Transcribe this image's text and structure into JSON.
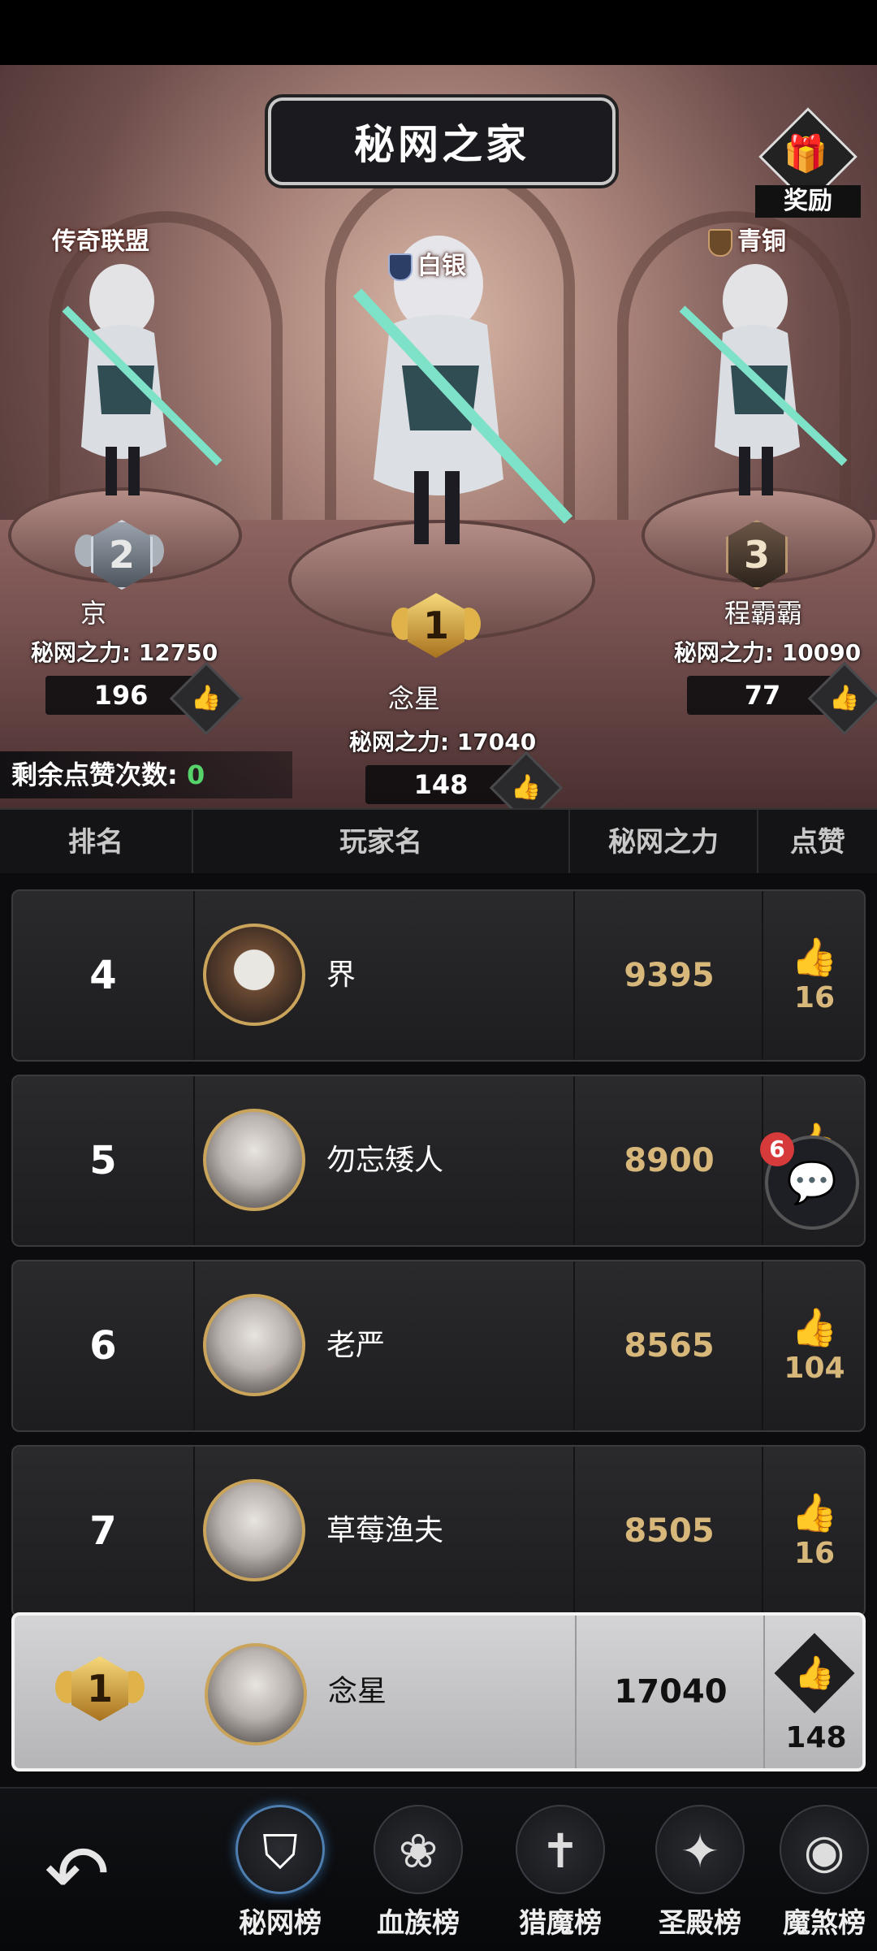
{
  "header": {
    "title": "秘网之家",
    "reward_label": "奖励"
  },
  "podium": {
    "first": {
      "tier": "白银",
      "rank": "1",
      "name": "念星",
      "power_text": "秘网之力: 17040",
      "likes": "148"
    },
    "second": {
      "tier": "传奇联盟",
      "rank": "2",
      "name": "京",
      "power_text": "秘网之力: 12750",
      "likes": "196"
    },
    "third": {
      "tier": "青铜",
      "rank": "3",
      "name": "程霸霸",
      "power_text": "秘网之力: 10090",
      "likes": "77"
    }
  },
  "remaining_likes": {
    "label": "剩余点赞次数:",
    "value": "0"
  },
  "table": {
    "headers": [
      "排名",
      "玩家名",
      "秘网之力",
      "点赞"
    ],
    "rows": [
      {
        "rank": "4",
        "name": "界",
        "power": "9395",
        "likes": "16"
      },
      {
        "rank": "5",
        "name": "勿忘矮人",
        "power": "8900",
        "likes": ""
      },
      {
        "rank": "6",
        "name": "老严",
        "power": "8565",
        "likes": "104"
      },
      {
        "rank": "7",
        "name": "草莓渔夫",
        "power": "8505",
        "likes": "16"
      }
    ],
    "self": {
      "rank": "1",
      "name": "念星",
      "power": "17040",
      "likes": "148"
    }
  },
  "chat": {
    "badge": "6"
  },
  "tabs": [
    {
      "label": "秘网榜",
      "icon": "hood-icon"
    },
    {
      "label": "血族榜",
      "icon": "rose-icon"
    },
    {
      "label": "猎魔榜",
      "icon": "cross-icon"
    },
    {
      "label": "圣殿榜",
      "icon": "wings-icon"
    },
    {
      "label": "魔煞榜",
      "icon": "eye-icon"
    }
  ]
}
